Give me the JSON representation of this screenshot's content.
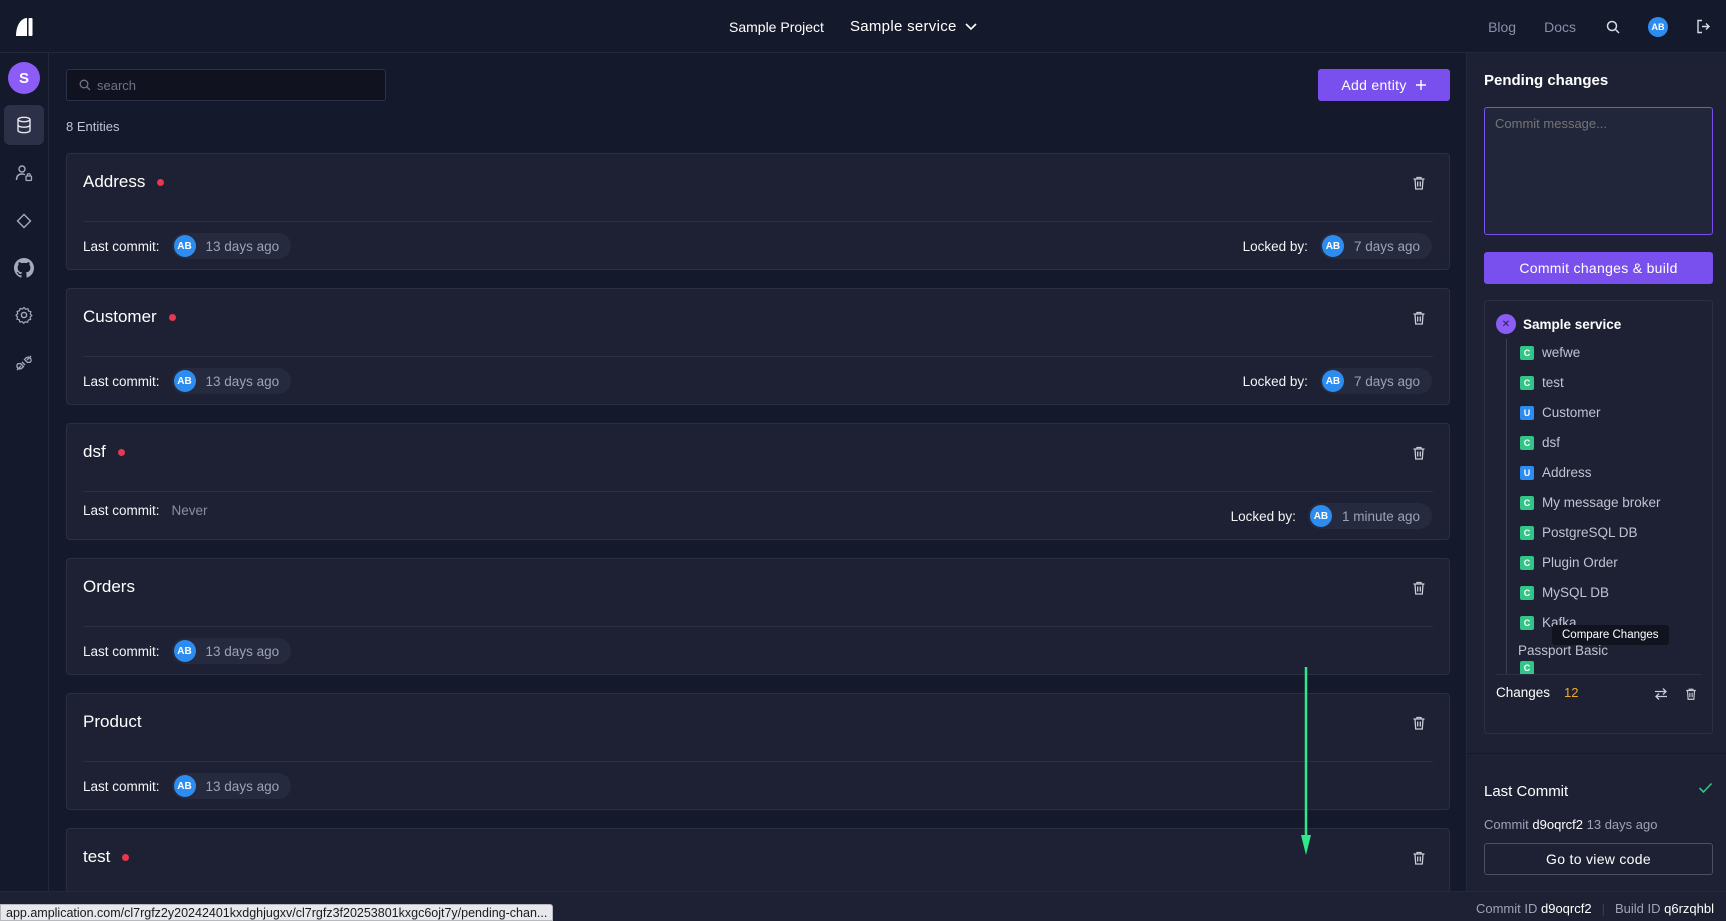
{
  "header": {
    "project": "Sample Project",
    "service": "Sample service",
    "blog": "Blog",
    "docs": "Docs",
    "user_initials": "AB"
  },
  "rail": {
    "workspace_initial": "S"
  },
  "main": {
    "search_placeholder": "search",
    "add_entity_label": "Add entity",
    "entity_count": "8 Entities",
    "last_commit_label": "Last commit:",
    "locked_by_label": "Locked by:",
    "entities": [
      {
        "name": "Address",
        "pending": true,
        "last_commit_user": "AB",
        "last_commit_time": "13 days ago",
        "locked_user": "AB",
        "locked_time": "7 days ago"
      },
      {
        "name": "Customer",
        "pending": true,
        "last_commit_user": "AB",
        "last_commit_time": "13 days ago",
        "locked_user": "AB",
        "locked_time": "7 days ago"
      },
      {
        "name": "dsf",
        "pending": true,
        "last_commit_never": "Never",
        "locked_user": "AB",
        "locked_time": "1 minute ago"
      },
      {
        "name": "Orders",
        "pending": false,
        "last_commit_user": "AB",
        "last_commit_time": "13 days ago"
      },
      {
        "name": "Product",
        "pending": false,
        "last_commit_user": "AB",
        "last_commit_time": "13 days ago"
      },
      {
        "name": "test",
        "pending": true
      }
    ]
  },
  "panel": {
    "title": "Pending changes",
    "commit_placeholder": "Commit message...",
    "commit_button": "Commit changes & build",
    "service_name": "Sample service",
    "changes": [
      {
        "type": "C",
        "name": "wefwe"
      },
      {
        "type": "C",
        "name": "test"
      },
      {
        "type": "U",
        "name": "Customer"
      },
      {
        "type": "C",
        "name": "dsf"
      },
      {
        "type": "U",
        "name": "Address"
      },
      {
        "type": "C",
        "name": "My message broker"
      },
      {
        "type": "C",
        "name": "PostgreSQL DB"
      },
      {
        "type": "C",
        "name": "Plugin Order"
      },
      {
        "type": "C",
        "name": "MySQL DB"
      },
      {
        "type": "C",
        "name": "Kafka"
      },
      {
        "type": "C",
        "name": "Passport Basic"
      }
    ],
    "tooltip": "Compare Changes",
    "changes_label": "Changes",
    "changes_count": "12",
    "last_commit_title": "Last Commit",
    "last_commit_prefix": "Commit",
    "last_commit_id": "d9oqrcf2",
    "last_commit_time": "13 days ago",
    "view_code_button": "Go to view code"
  },
  "status": {
    "commit_label": "Commit ID",
    "commit_id": "d9oqrcf2",
    "build_label": "Build ID",
    "build_id": "q6rzqhbl",
    "url_hint": "app.amplication.com/cl7rgfz2y20242401kxdghjugxv/cl7rgfz3f20253801kxgc6ojt7y/pending-chan..."
  },
  "colors": {
    "accent": "#7950ed",
    "pending_dot": "#e8384f",
    "create_badge": "#31c587",
    "update_badge": "#2d8cf0",
    "changes_count": "#f5a623",
    "annotation_arrow": "#2ee88a"
  }
}
